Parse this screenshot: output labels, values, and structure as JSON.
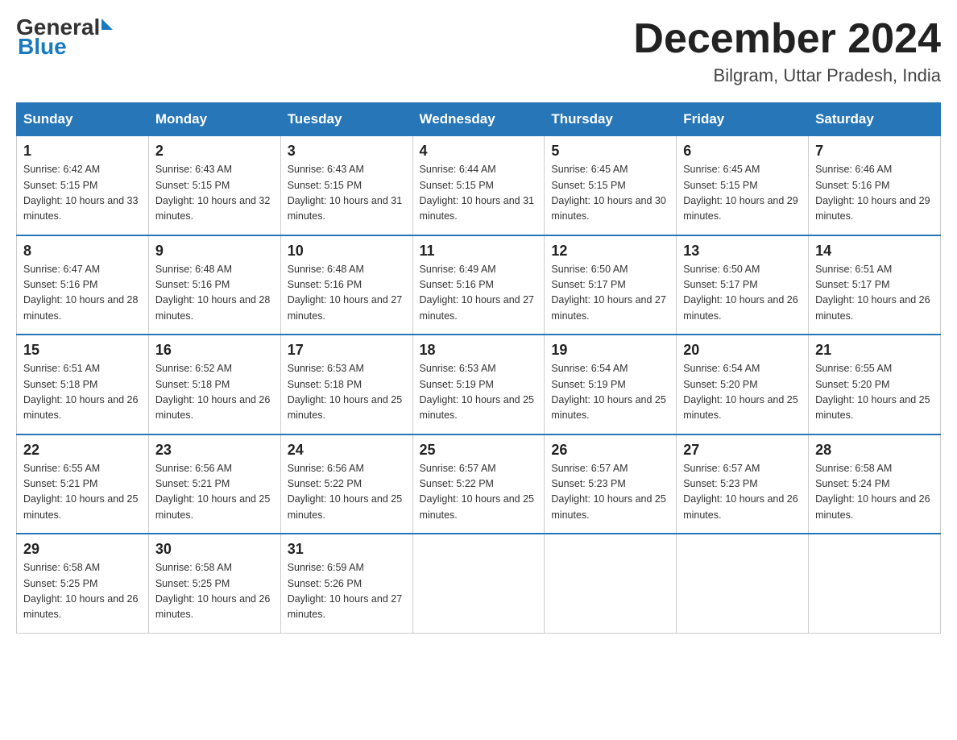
{
  "header": {
    "logo_line1": "General",
    "logo_line2": "Blue",
    "title": "December 2024",
    "subtitle": "Bilgram, Uttar Pradesh, India"
  },
  "days_of_week": [
    "Sunday",
    "Monday",
    "Tuesday",
    "Wednesday",
    "Thursday",
    "Friday",
    "Saturday"
  ],
  "weeks": [
    [
      {
        "day": "1",
        "sunrise": "6:42 AM",
        "sunset": "5:15 PM",
        "daylight": "10 hours and 33 minutes."
      },
      {
        "day": "2",
        "sunrise": "6:43 AM",
        "sunset": "5:15 PM",
        "daylight": "10 hours and 32 minutes."
      },
      {
        "day": "3",
        "sunrise": "6:43 AM",
        "sunset": "5:15 PM",
        "daylight": "10 hours and 31 minutes."
      },
      {
        "day": "4",
        "sunrise": "6:44 AM",
        "sunset": "5:15 PM",
        "daylight": "10 hours and 31 minutes."
      },
      {
        "day": "5",
        "sunrise": "6:45 AM",
        "sunset": "5:15 PM",
        "daylight": "10 hours and 30 minutes."
      },
      {
        "day": "6",
        "sunrise": "6:45 AM",
        "sunset": "5:15 PM",
        "daylight": "10 hours and 29 minutes."
      },
      {
        "day": "7",
        "sunrise": "6:46 AM",
        "sunset": "5:16 PM",
        "daylight": "10 hours and 29 minutes."
      }
    ],
    [
      {
        "day": "8",
        "sunrise": "6:47 AM",
        "sunset": "5:16 PM",
        "daylight": "10 hours and 28 minutes."
      },
      {
        "day": "9",
        "sunrise": "6:48 AM",
        "sunset": "5:16 PM",
        "daylight": "10 hours and 28 minutes."
      },
      {
        "day": "10",
        "sunrise": "6:48 AM",
        "sunset": "5:16 PM",
        "daylight": "10 hours and 27 minutes."
      },
      {
        "day": "11",
        "sunrise": "6:49 AM",
        "sunset": "5:16 PM",
        "daylight": "10 hours and 27 minutes."
      },
      {
        "day": "12",
        "sunrise": "6:50 AM",
        "sunset": "5:17 PM",
        "daylight": "10 hours and 27 minutes."
      },
      {
        "day": "13",
        "sunrise": "6:50 AM",
        "sunset": "5:17 PM",
        "daylight": "10 hours and 26 minutes."
      },
      {
        "day": "14",
        "sunrise": "6:51 AM",
        "sunset": "5:17 PM",
        "daylight": "10 hours and 26 minutes."
      }
    ],
    [
      {
        "day": "15",
        "sunrise": "6:51 AM",
        "sunset": "5:18 PM",
        "daylight": "10 hours and 26 minutes."
      },
      {
        "day": "16",
        "sunrise": "6:52 AM",
        "sunset": "5:18 PM",
        "daylight": "10 hours and 26 minutes."
      },
      {
        "day": "17",
        "sunrise": "6:53 AM",
        "sunset": "5:18 PM",
        "daylight": "10 hours and 25 minutes."
      },
      {
        "day": "18",
        "sunrise": "6:53 AM",
        "sunset": "5:19 PM",
        "daylight": "10 hours and 25 minutes."
      },
      {
        "day": "19",
        "sunrise": "6:54 AM",
        "sunset": "5:19 PM",
        "daylight": "10 hours and 25 minutes."
      },
      {
        "day": "20",
        "sunrise": "6:54 AM",
        "sunset": "5:20 PM",
        "daylight": "10 hours and 25 minutes."
      },
      {
        "day": "21",
        "sunrise": "6:55 AM",
        "sunset": "5:20 PM",
        "daylight": "10 hours and 25 minutes."
      }
    ],
    [
      {
        "day": "22",
        "sunrise": "6:55 AM",
        "sunset": "5:21 PM",
        "daylight": "10 hours and 25 minutes."
      },
      {
        "day": "23",
        "sunrise": "6:56 AM",
        "sunset": "5:21 PM",
        "daylight": "10 hours and 25 minutes."
      },
      {
        "day": "24",
        "sunrise": "6:56 AM",
        "sunset": "5:22 PM",
        "daylight": "10 hours and 25 minutes."
      },
      {
        "day": "25",
        "sunrise": "6:57 AM",
        "sunset": "5:22 PM",
        "daylight": "10 hours and 25 minutes."
      },
      {
        "day": "26",
        "sunrise": "6:57 AM",
        "sunset": "5:23 PM",
        "daylight": "10 hours and 25 minutes."
      },
      {
        "day": "27",
        "sunrise": "6:57 AM",
        "sunset": "5:23 PM",
        "daylight": "10 hours and 26 minutes."
      },
      {
        "day": "28",
        "sunrise": "6:58 AM",
        "sunset": "5:24 PM",
        "daylight": "10 hours and 26 minutes."
      }
    ],
    [
      {
        "day": "29",
        "sunrise": "6:58 AM",
        "sunset": "5:25 PM",
        "daylight": "10 hours and 26 minutes."
      },
      {
        "day": "30",
        "sunrise": "6:58 AM",
        "sunset": "5:25 PM",
        "daylight": "10 hours and 26 minutes."
      },
      {
        "day": "31",
        "sunrise": "6:59 AM",
        "sunset": "5:26 PM",
        "daylight": "10 hours and 27 minutes."
      },
      null,
      null,
      null,
      null
    ]
  ]
}
